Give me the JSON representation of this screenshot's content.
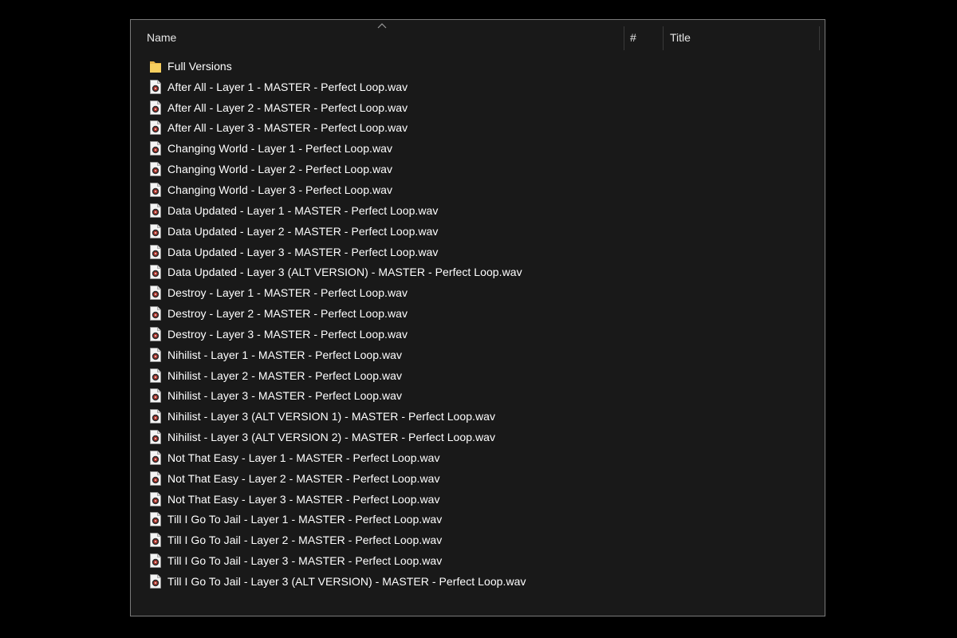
{
  "columns": {
    "name": "Name",
    "number": "#",
    "title": "Title"
  },
  "colors": {
    "background": "#000000",
    "window": "#191919",
    "border": "#7a7a7a",
    "text": "#ffffff",
    "folder": "#f5c85a"
  },
  "items": [
    {
      "type": "folder",
      "icon": "folder-icon",
      "name": "Full Versions"
    },
    {
      "type": "file",
      "icon": "audio-file-icon",
      "name": "After All - Layer 1 - MASTER - Perfect Loop.wav"
    },
    {
      "type": "file",
      "icon": "audio-file-icon",
      "name": "After All - Layer 2 - MASTER - Perfect Loop.wav"
    },
    {
      "type": "file",
      "icon": "audio-file-icon",
      "name": "After All - Layer 3 - MASTER - Perfect Loop.wav"
    },
    {
      "type": "file",
      "icon": "audio-file-icon",
      "name": "Changing World - Layer 1 - Perfect Loop.wav"
    },
    {
      "type": "file",
      "icon": "audio-file-icon",
      "name": "Changing World - Layer 2 - Perfect Loop.wav"
    },
    {
      "type": "file",
      "icon": "audio-file-icon",
      "name": "Changing World - Layer 3 - Perfect Loop.wav"
    },
    {
      "type": "file",
      "icon": "audio-file-icon",
      "name": "Data Updated - Layer 1 - MASTER - Perfect Loop.wav"
    },
    {
      "type": "file",
      "icon": "audio-file-icon",
      "name": "Data Updated - Layer 2 - MASTER - Perfect Loop.wav"
    },
    {
      "type": "file",
      "icon": "audio-file-icon",
      "name": "Data Updated - Layer 3 - MASTER - Perfect Loop.wav"
    },
    {
      "type": "file",
      "icon": "audio-file-icon",
      "name": "Data Updated - Layer 3 (ALT VERSION) - MASTER - Perfect Loop.wav"
    },
    {
      "type": "file",
      "icon": "audio-file-icon",
      "name": "Destroy - Layer 1 - MASTER - Perfect Loop.wav"
    },
    {
      "type": "file",
      "icon": "audio-file-icon",
      "name": "Destroy - Layer 2 - MASTER - Perfect Loop.wav"
    },
    {
      "type": "file",
      "icon": "audio-file-icon",
      "name": "Destroy - Layer 3 - MASTER - Perfect Loop.wav"
    },
    {
      "type": "file",
      "icon": "audio-file-icon",
      "name": "Nihilist - Layer 1 - MASTER - Perfect Loop.wav"
    },
    {
      "type": "file",
      "icon": "audio-file-icon",
      "name": "Nihilist - Layer 2 - MASTER - Perfect Loop.wav"
    },
    {
      "type": "file",
      "icon": "audio-file-icon",
      "name": "Nihilist - Layer 3 - MASTER - Perfect Loop.wav"
    },
    {
      "type": "file",
      "icon": "audio-file-icon",
      "name": "Nihilist - Layer 3 (ALT VERSION 1) - MASTER - Perfect Loop.wav"
    },
    {
      "type": "file",
      "icon": "audio-file-icon",
      "name": "Nihilist - Layer 3 (ALT VERSION 2) - MASTER - Perfect Loop.wav"
    },
    {
      "type": "file",
      "icon": "audio-file-icon",
      "name": "Not That Easy - Layer 1 - MASTER - Perfect Loop.wav"
    },
    {
      "type": "file",
      "icon": "audio-file-icon",
      "name": "Not That Easy - Layer 2 - MASTER - Perfect Loop.wav"
    },
    {
      "type": "file",
      "icon": "audio-file-icon",
      "name": "Not That Easy - Layer 3 - MASTER - Perfect Loop.wav"
    },
    {
      "type": "file",
      "icon": "audio-file-icon",
      "name": "Till I Go To Jail - Layer 1 - MASTER - Perfect Loop.wav"
    },
    {
      "type": "file",
      "icon": "audio-file-icon",
      "name": "Till I Go To Jail - Layer 2 - MASTER - Perfect Loop.wav"
    },
    {
      "type": "file",
      "icon": "audio-file-icon",
      "name": "Till I Go To Jail - Layer 3 - MASTER - Perfect Loop.wav"
    },
    {
      "type": "file",
      "icon": "audio-file-icon",
      "name": "Till I Go To Jail - Layer 3 (ALT VERSION) - MASTER - Perfect Loop.wav"
    }
  ]
}
